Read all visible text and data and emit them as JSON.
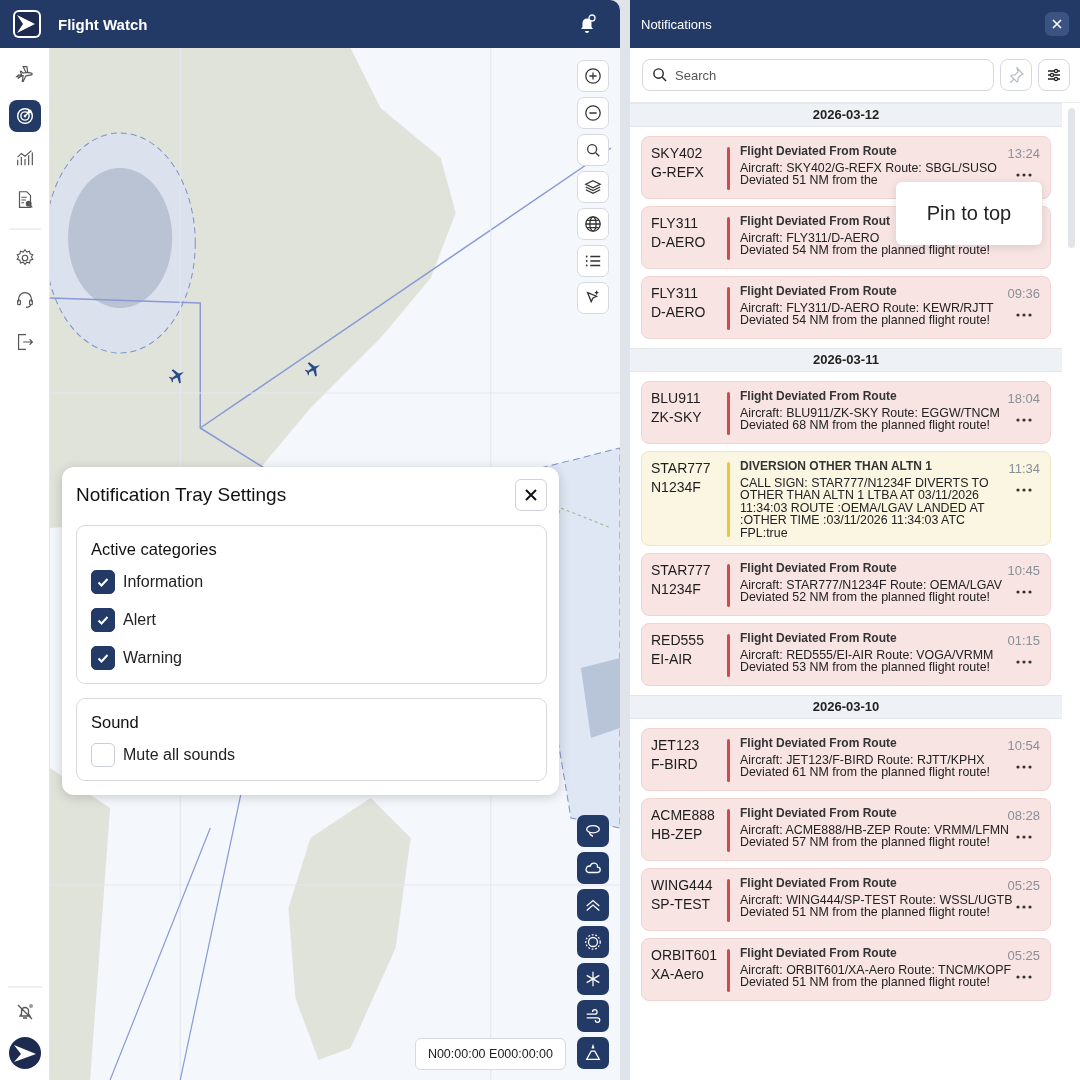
{
  "app": {
    "title": "Flight Watch"
  },
  "sidebar": {
    "groups": [
      {
        "items": [
          {
            "kind": "flights",
            "selected": false
          },
          {
            "kind": "tracking",
            "selected": true
          },
          {
            "kind": "analytics",
            "selected": false
          },
          {
            "kind": "reports",
            "selected": false
          }
        ]
      },
      {
        "items": [
          {
            "kind": "settings",
            "selected": false
          },
          {
            "kind": "support",
            "selected": false
          },
          {
            "kind": "logout",
            "selected": false
          }
        ]
      }
    ]
  },
  "map": {
    "coordinates": "N00:00:00 E000:00:00"
  },
  "settings_dialog": {
    "title": "Notification Tray Settings",
    "sections": [
      {
        "heading": "Active categories",
        "options": [
          {
            "label": "Information",
            "checked": true
          },
          {
            "label": "Alert",
            "checked": true
          },
          {
            "label": "Warning",
            "checked": true
          }
        ]
      },
      {
        "heading": "Sound",
        "options": [
          {
            "label": "Mute all sounds",
            "checked": false
          }
        ]
      }
    ]
  },
  "notifications": {
    "title": "Notifications",
    "search": {
      "placeholder": "Search"
    },
    "groups": [
      {
        "date": "2026-03-12",
        "items": [
          {
            "callsign": "SKY402",
            "registration": "G-REFX",
            "kind": "alert",
            "title": "Flight Deviated From Route",
            "lines": [
              "Aircraft: SKY402/G-REFX Route: SBGL/SUSO",
              "Deviated 51 NM from the"
            ],
            "time": "13:24"
          },
          {
            "callsign": "FLY311",
            "registration": "D-AERO",
            "kind": "alert",
            "title": "Flight Deviated From Rout",
            "lines": [
              "Aircraft: FLY311/D-AERO",
              "Deviated 54 NM from the planned flight route!"
            ]
          },
          {
            "callsign": "FLY311",
            "registration": "D-AERO",
            "kind": "alert",
            "title": "Flight Deviated From Route",
            "lines": [
              "Aircraft: FLY311/D-AERO Route: KEWR/RJTT",
              "Deviated 54 NM from the planned flight route!"
            ],
            "time": "09:36"
          }
        ]
      },
      {
        "date": "2026-03-11",
        "items": [
          {
            "callsign": "BLU911",
            "registration": "ZK-SKY",
            "kind": "alert",
            "title": "Flight Deviated From Route",
            "lines": [
              "Aircraft: BLU911/ZK-SKY Route: EGGW/TNCM",
              "Deviated 68 NM from the planned flight route!"
            ],
            "time": "18:04"
          },
          {
            "callsign": "STAR777",
            "registration": "N1234F",
            "kind": "warning",
            "title": "DIVERSION OTHER THAN ALTN 1",
            "lines": [
              "CALL SIGN: STAR777/N1234F DIVERTS TO OTHER THAN ALTN 1 LTBA AT 03/11/2026 11:34:03 ROUTE :OEMA/LGAV LANDED AT :OTHER TIME :03/11/2026 11:34:03 ATC FPL:true"
            ],
            "time": "11:34"
          },
          {
            "callsign": "STAR777",
            "registration": "N1234F",
            "kind": "alert",
            "title": "Flight Deviated From Route",
            "lines": [
              "Aircraft: STAR777/N1234F Route: OEMA/LGAV",
              "Deviated 52 NM from the planned flight route!"
            ],
            "time": "10:45"
          },
          {
            "callsign": "RED555",
            "registration": "EI-AIR",
            "kind": "alert",
            "title": "Flight Deviated From Route",
            "lines": [
              "Aircraft: RED555/EI-AIR Route: VOGA/VRMM",
              "Deviated 53 NM from the planned flight route!"
            ],
            "time": "01:15"
          }
        ]
      },
      {
        "date": "2026-03-10",
        "items": [
          {
            "callsign": "JET123",
            "registration": "F-BIRD",
            "kind": "alert",
            "title": "Flight Deviated From Route",
            "lines": [
              "Aircraft: JET123/F-BIRD Route: RJTT/KPHX",
              "Deviated 61 NM from the planned flight route!"
            ],
            "time": "10:54"
          },
          {
            "callsign": "ACME888",
            "registration": "HB-ZEP",
            "kind": "alert",
            "title": "Flight Deviated From Route",
            "lines": [
              "Aircraft: ACME888/HB-ZEP Route: VRMM/LFMN",
              "Deviated 57 NM from the planned flight route!"
            ],
            "time": "08:28"
          },
          {
            "callsign": "WING444",
            "registration": "SP-TEST",
            "kind": "alert",
            "title": "Flight Deviated From Route",
            "lines": [
              "Aircraft: WING444/SP-TEST Route: WSSL/UGTB",
              "Deviated 51 NM from the planned flight route!"
            ],
            "time": "05:25"
          },
          {
            "callsign": "ORBIT601",
            "registration": "XA-Aero",
            "kind": "alert",
            "title": "Flight Deviated From Route",
            "lines": [
              "Aircraft: ORBIT601/XA-Aero Route: TNCM/KOPF",
              "Deviated 51 NM from the planned flight route!"
            ],
            "time": "05:25"
          }
        ]
      }
    ],
    "menu": {
      "items": [
        {
          "label": "Pin to top"
        }
      ]
    }
  }
}
